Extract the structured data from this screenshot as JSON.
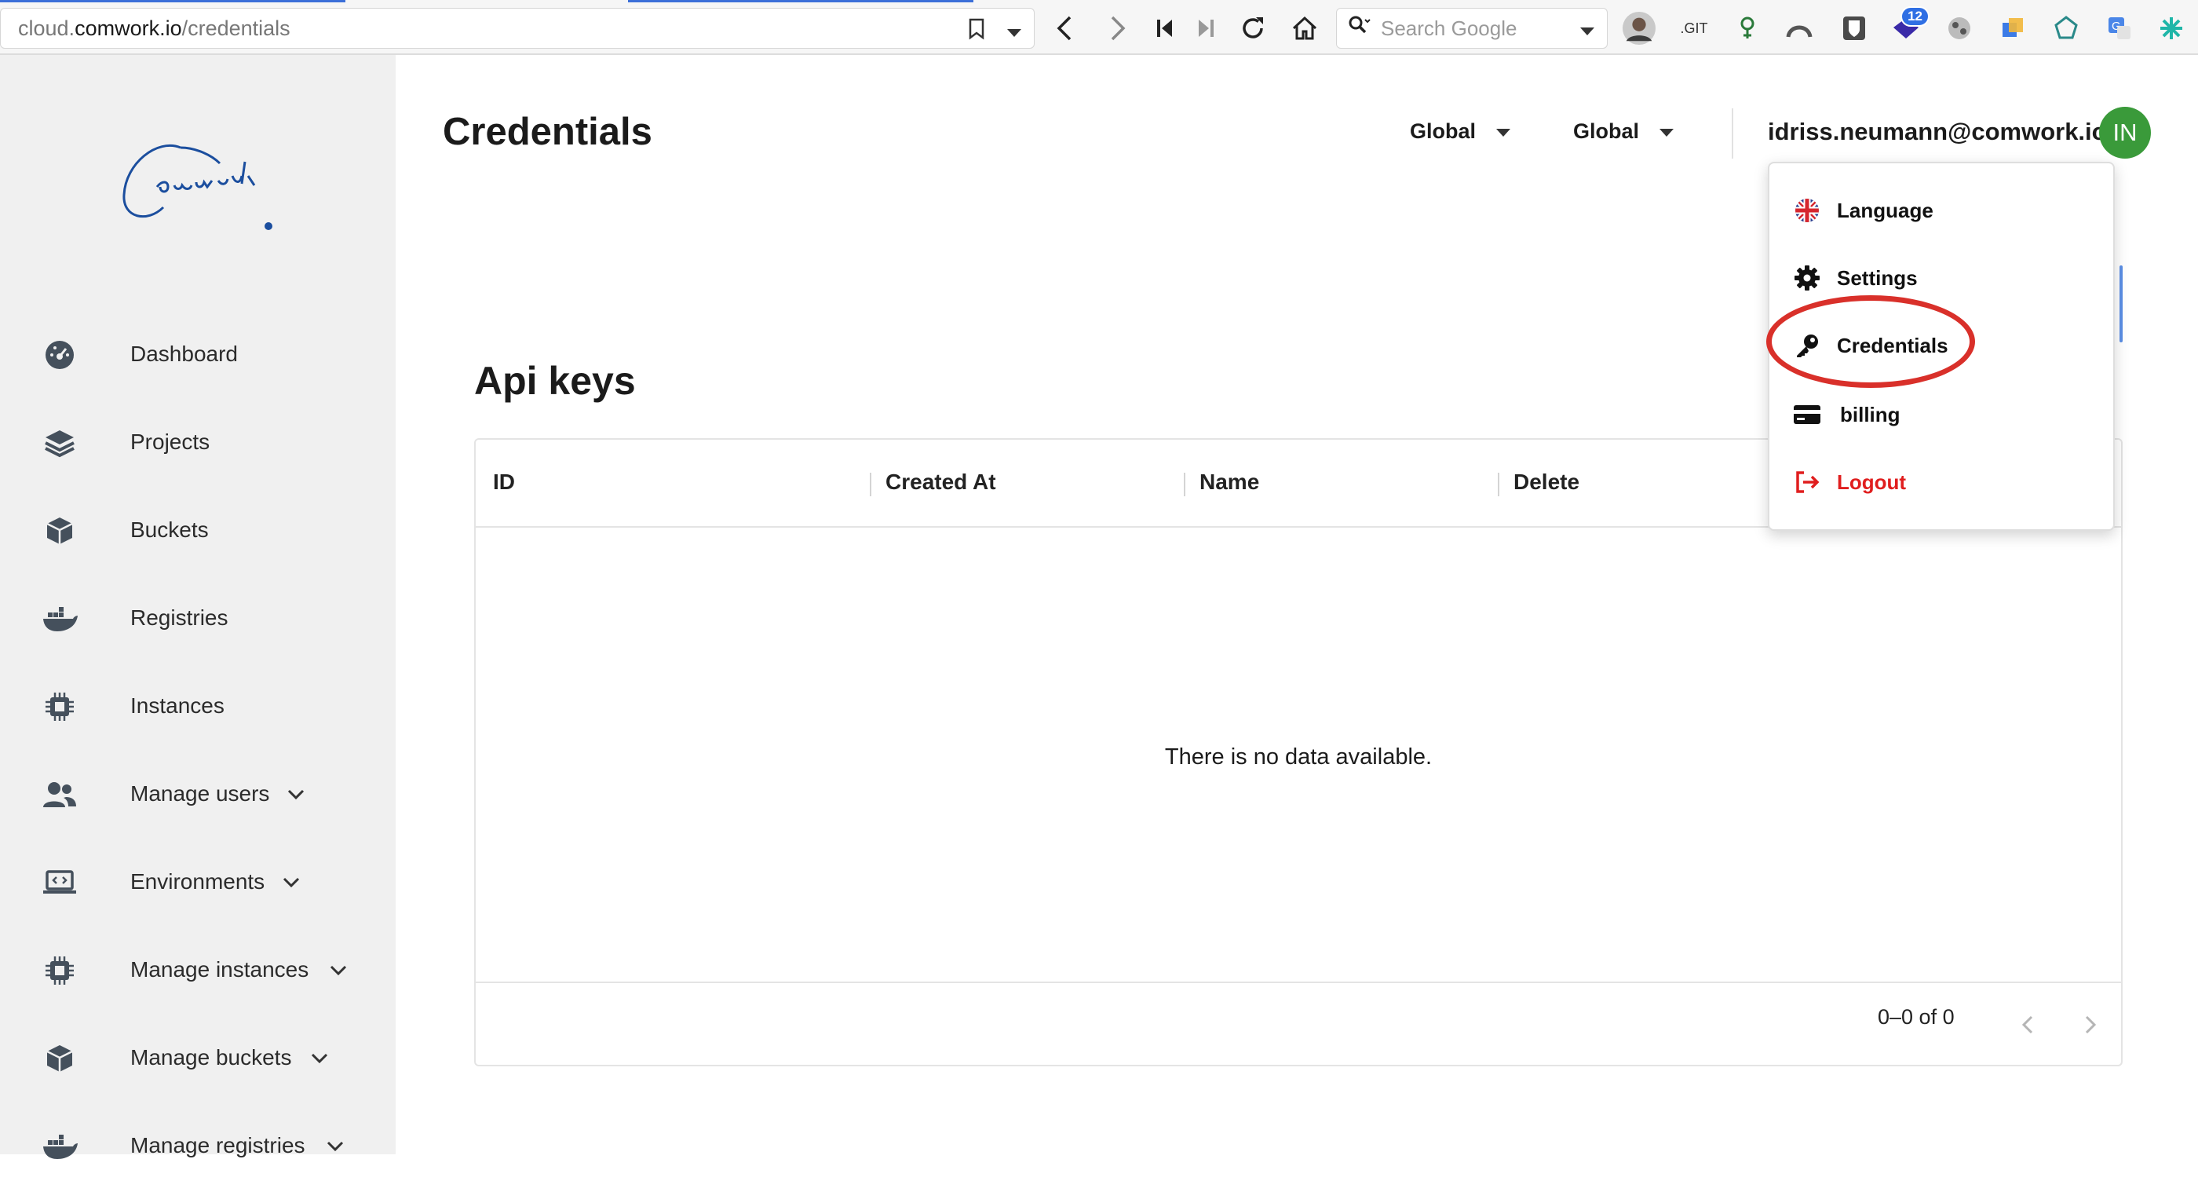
{
  "browser": {
    "url_prefix": "cloud.",
    "url_host": "comwork.io",
    "url_path": "/credentials",
    "search_placeholder": "Search Google",
    "extensions": [
      {
        "name": "profile-avatar-icon"
      },
      {
        "name": "git-extension-icon",
        "text": ".GIT"
      },
      {
        "name": "extension-icon"
      },
      {
        "name": "extension-icon"
      },
      {
        "name": "bitwarden-icon"
      },
      {
        "name": "extension-badge-icon",
        "badge": "12"
      },
      {
        "name": "extension-icon"
      },
      {
        "name": "extension-icon"
      },
      {
        "name": "extension-icon"
      },
      {
        "name": "translate-icon"
      },
      {
        "name": "extension-icon"
      }
    ]
  },
  "sidebar": {
    "logo_alt": "Comwork",
    "items": [
      {
        "label": "Dashboard",
        "icon": "dashboard-icon",
        "expandable": false
      },
      {
        "label": "Projects",
        "icon": "layers-icon",
        "expandable": false
      },
      {
        "label": "Buckets",
        "icon": "cube-icon",
        "expandable": false
      },
      {
        "label": "Registries",
        "icon": "docker-icon",
        "expandable": false
      },
      {
        "label": "Instances",
        "icon": "chip-icon",
        "expandable": false
      },
      {
        "label": "Manage users",
        "icon": "users-icon",
        "expandable": true
      },
      {
        "label": "Environments",
        "icon": "laptop-code-icon",
        "expandable": true
      },
      {
        "label": "Manage instances",
        "icon": "chip-icon",
        "expandable": true
      },
      {
        "label": "Manage buckets",
        "icon": "cube-icon",
        "expandable": true
      },
      {
        "label": "Manage registries",
        "icon": "docker-icon",
        "expandable": true
      }
    ]
  },
  "header": {
    "title": "Credentials",
    "region_select_1": "Global",
    "region_select_2": "Global",
    "user_email": "idriss.neumann@comwork.io",
    "avatar_initials": "IN",
    "avatar_color": "#3a9a3a"
  },
  "api_keys": {
    "title": "Api keys",
    "columns": [
      "ID",
      "Created At",
      "Name",
      "Delete"
    ],
    "rows": [],
    "empty_message": "There is no data available.",
    "pagination_text": "0–0 of 0"
  },
  "user_menu": {
    "items": [
      {
        "label": "Language",
        "icon": "uk-flag-icon"
      },
      {
        "label": "Settings",
        "icon": "gear-icon"
      },
      {
        "label": "Credentials",
        "icon": "key-icon",
        "highlighted": true
      },
      {
        "label": "billing",
        "icon": "credit-card-icon"
      },
      {
        "label": "Logout",
        "icon": "logout-icon",
        "color": "#e01e1e"
      }
    ],
    "highlight_color": "#d9302a"
  }
}
